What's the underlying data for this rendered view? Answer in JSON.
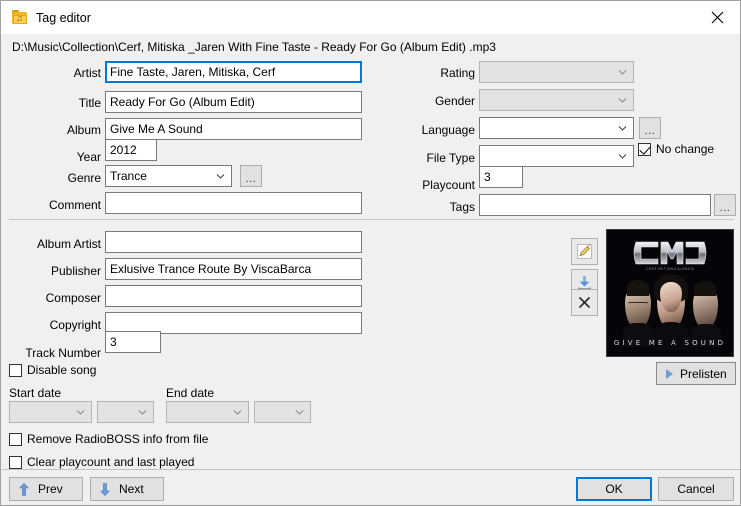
{
  "window": {
    "title": "Tag editor",
    "icon": "folder-music-icon",
    "close_label": "✕",
    "file_path": "D:\\Music\\Collection\\Cerf, Mitiska _Jaren With Fine Taste - Ready For Go (Album Edit) .mp3"
  },
  "left_fields": [
    {
      "label": "Artist",
      "value": "Fine Taste, Jaren, Mitiska, Cerf"
    },
    {
      "label": "Title",
      "value": "Ready For Go (Album Edit)"
    },
    {
      "label": "Album",
      "value": "Give Me A Sound"
    },
    {
      "label": "Year",
      "value": "2012"
    },
    {
      "label": "Genre",
      "value": "Trance"
    },
    {
      "label": "Comment",
      "value": ""
    }
  ],
  "right_fields": [
    {
      "label": "Rating",
      "value": ""
    },
    {
      "label": "Gender",
      "value": ""
    },
    {
      "label": "Language",
      "value": ""
    },
    {
      "label": "File Type",
      "value": ""
    },
    {
      "label": "Playcount",
      "value": "3"
    },
    {
      "label": "Tags",
      "value": ""
    }
  ],
  "no_change": {
    "label": "No change",
    "checked": true
  },
  "detail_fields": [
    {
      "label": "Album Artist",
      "value": ""
    },
    {
      "label": "Publisher",
      "value": "Exlusive Trance Route By ViscaBarca"
    },
    {
      "label": "Composer",
      "value": ""
    },
    {
      "label": "Copyright",
      "value": ""
    },
    {
      "label": "Track Number",
      "value": "3"
    }
  ],
  "art": {
    "logo_text": "CMJ",
    "logo_sub": "CERF.MITISKA&JAREN",
    "title": "GIVE ME A SOUND"
  },
  "art_buttons": [
    {
      "name": "edit-image-button",
      "icon": "pencil-icon"
    },
    {
      "name": "download-image-button",
      "icon": "download-icon"
    },
    {
      "name": "remove-image-button",
      "icon": "close-x-icon"
    }
  ],
  "prelisten": {
    "label": "Prelisten",
    "icon": "play-icon"
  },
  "options": {
    "disable_song": {
      "label": "Disable song",
      "checked": false
    },
    "remove_info": {
      "label": "Remove RadioBOSS info from file",
      "checked": false
    },
    "clear_playcount": {
      "label": "Clear playcount and last played",
      "checked": false
    }
  },
  "dates": {
    "start_label": "Start date",
    "end_label": "End date",
    "start_date_value": "",
    "start_time_value": "",
    "end_date_value": "",
    "end_time_value": ""
  },
  "footer": {
    "prev": "Prev",
    "next": "Next",
    "ok": "OK",
    "cancel": "Cancel"
  },
  "ellipsis": "...",
  "colors": {
    "dialog_bg": "#f0f0f0",
    "accent": "#0078d7",
    "field_border": "#7a7a7a",
    "disabled_bg": "#e3e3e3",
    "arrow_blue": "#4a86c8"
  }
}
